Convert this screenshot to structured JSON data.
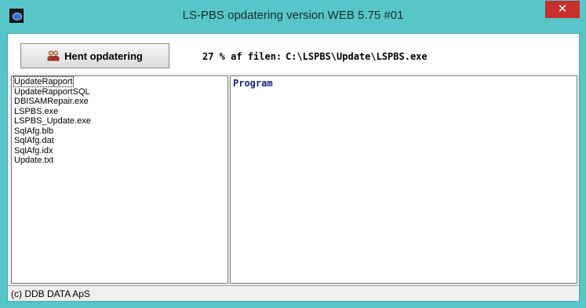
{
  "window": {
    "title": "LS-PBS opdatering version WEB  5.75  #01",
    "close_glyph": "✕",
    "icon": "app-icon"
  },
  "toolbar": {
    "update_button_label": "Hent opdatering",
    "update_button_icon": "people-icon",
    "progress_text": "27 % af filen:",
    "progress_percent": 27,
    "file_path": "C:\\LSPBS\\Update\\LSPBS.exe"
  },
  "file_list": {
    "items": [
      "UpdateRapport",
      "UpdateRapportSQL",
      "DBISAMRepair.exe",
      "LSPBS.exe",
      "LSPBS_Update.exe",
      "SqlAfg.blb",
      "SqlAfg.dat",
      "SqlAfg.idx",
      "Update.txt"
    ],
    "focused_index": 0
  },
  "program_panel": {
    "label": "Program"
  },
  "statusbar": {
    "text": "(c) DDB DATA ApS"
  },
  "colors": {
    "titlebar": "#57c6c9",
    "close_button": "#c7302b",
    "program_label": "#1a237e"
  }
}
